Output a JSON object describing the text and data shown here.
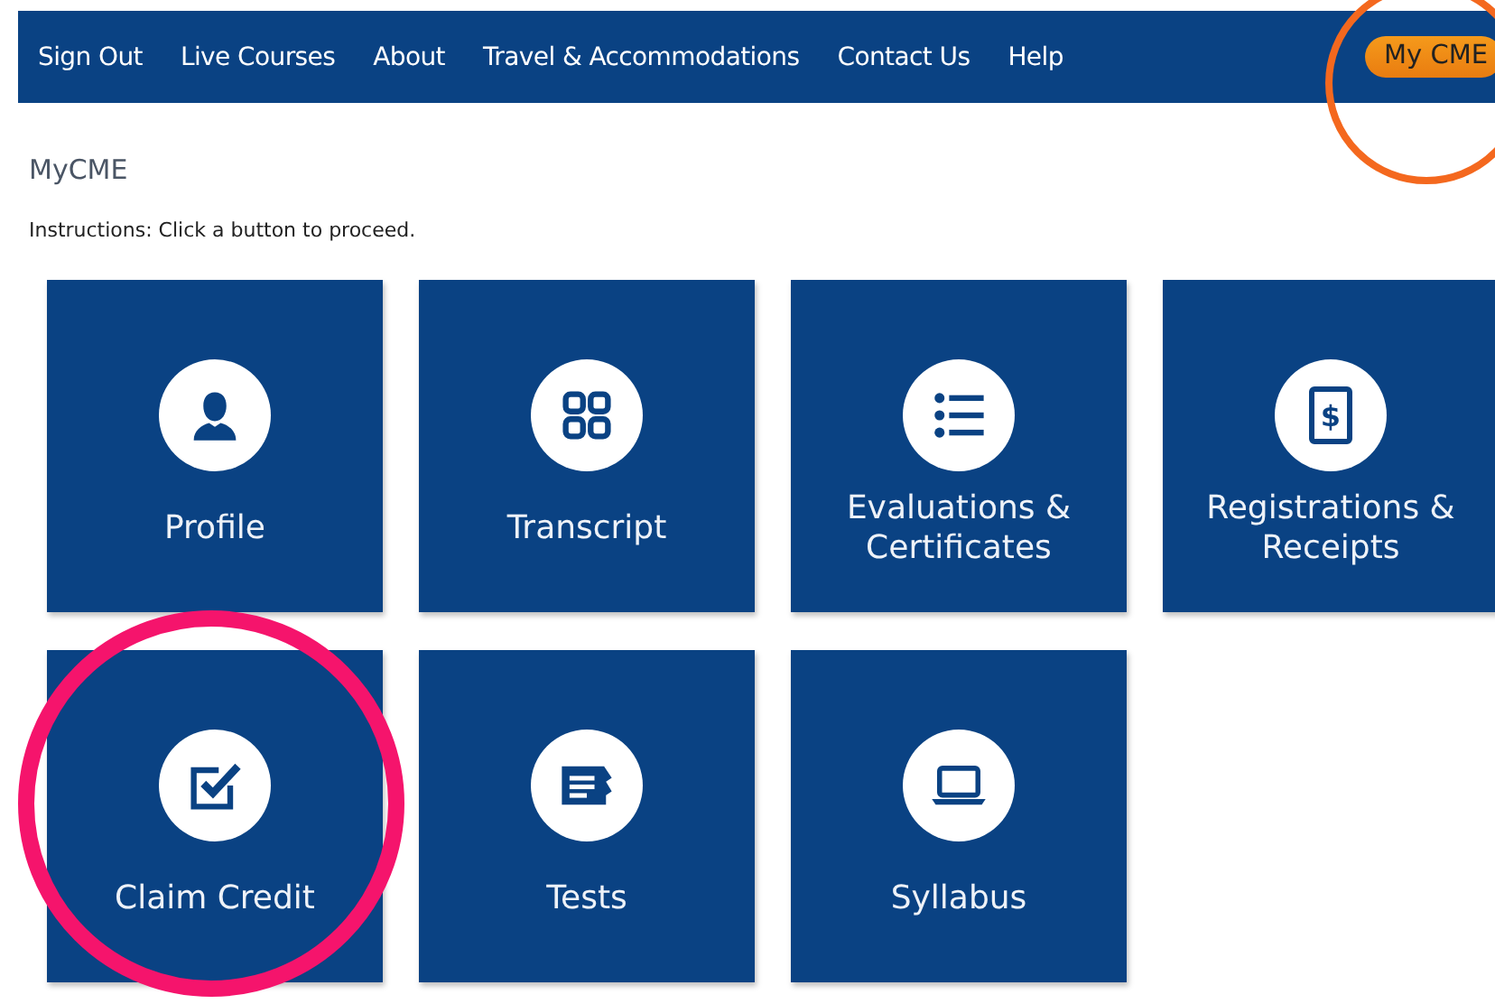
{
  "nav": {
    "links": [
      {
        "label": "Sign Out"
      },
      {
        "label": "Live Courses"
      },
      {
        "label": "About"
      },
      {
        "label": "Travel & Accommodations"
      },
      {
        "label": "Contact Us"
      },
      {
        "label": "Help"
      }
    ],
    "account_button": {
      "label": "My CME",
      "circled": true
    }
  },
  "page_title": "MyCME",
  "instructions": "Instructions: Click a button to proceed.",
  "tiles": [
    {
      "label": "Profile",
      "kind": "person",
      "circled": false
    },
    {
      "label": "Transcript",
      "kind": "grid",
      "circled": false
    },
    {
      "label": "Evaluations & Certificates",
      "kind": "list",
      "circled": false
    },
    {
      "label": "Registrations & Receipts",
      "kind": "receipt",
      "icon_text": "$",
      "circled": false
    },
    {
      "label": "Claim Credit",
      "kind": "checkbox",
      "circled": true
    },
    {
      "label": "Tests",
      "kind": "document",
      "circled": false
    },
    {
      "label": "Syllabus",
      "kind": "laptop",
      "circled": false
    }
  ]
}
